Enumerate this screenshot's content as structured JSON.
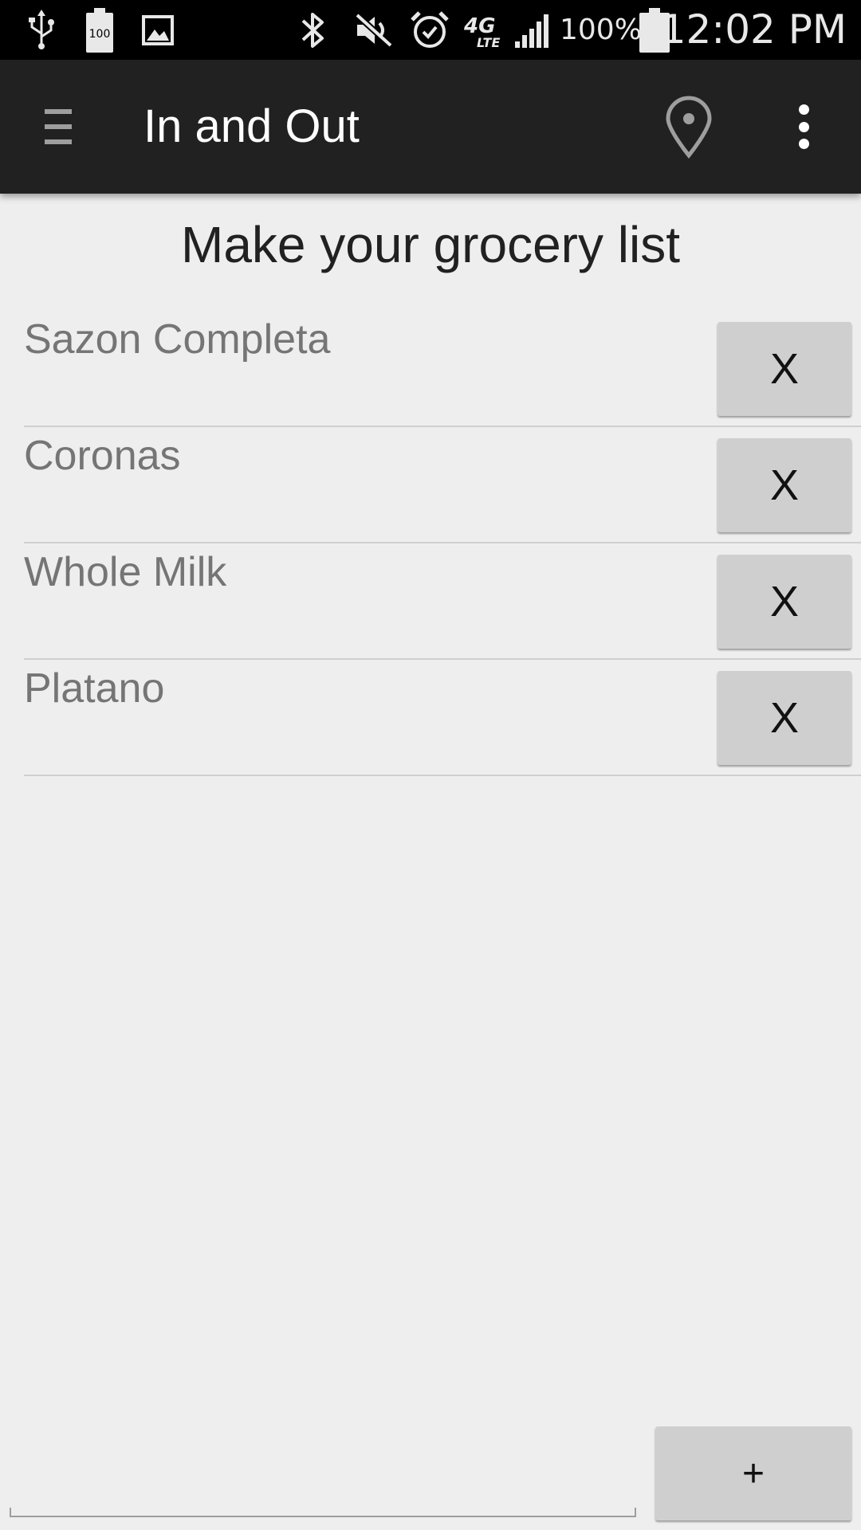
{
  "status_bar": {
    "battery_percent": "100%",
    "battery_icon_label": "100",
    "time": "12:02 PM",
    "icons": [
      "usb-icon",
      "battery-notification-icon",
      "image-icon",
      "bluetooth-icon",
      "mute-icon",
      "alarm-icon",
      "4g-lte-icon",
      "signal-icon",
      "battery-icon"
    ]
  },
  "app_bar": {
    "title": "In and Out",
    "icons": [
      "hamburger-icon",
      "location-pin-icon",
      "overflow-menu-icon"
    ]
  },
  "main": {
    "heading": "Make your grocery list",
    "items": [
      {
        "label": "Sazon Completa",
        "remove_label": "X"
      },
      {
        "label": "Coronas",
        "remove_label": "X"
      },
      {
        "label": "Whole Milk",
        "remove_label": "X"
      },
      {
        "label": "Platano",
        "remove_label": "X"
      }
    ]
  },
  "footer": {
    "input_value": "",
    "add_label": "+"
  },
  "colors": {
    "status_bar_bg": "#000000",
    "app_bar_bg": "#212121",
    "page_bg": "#eeeeee",
    "button_bg": "#cfcfcf",
    "item_text": "#757575"
  }
}
